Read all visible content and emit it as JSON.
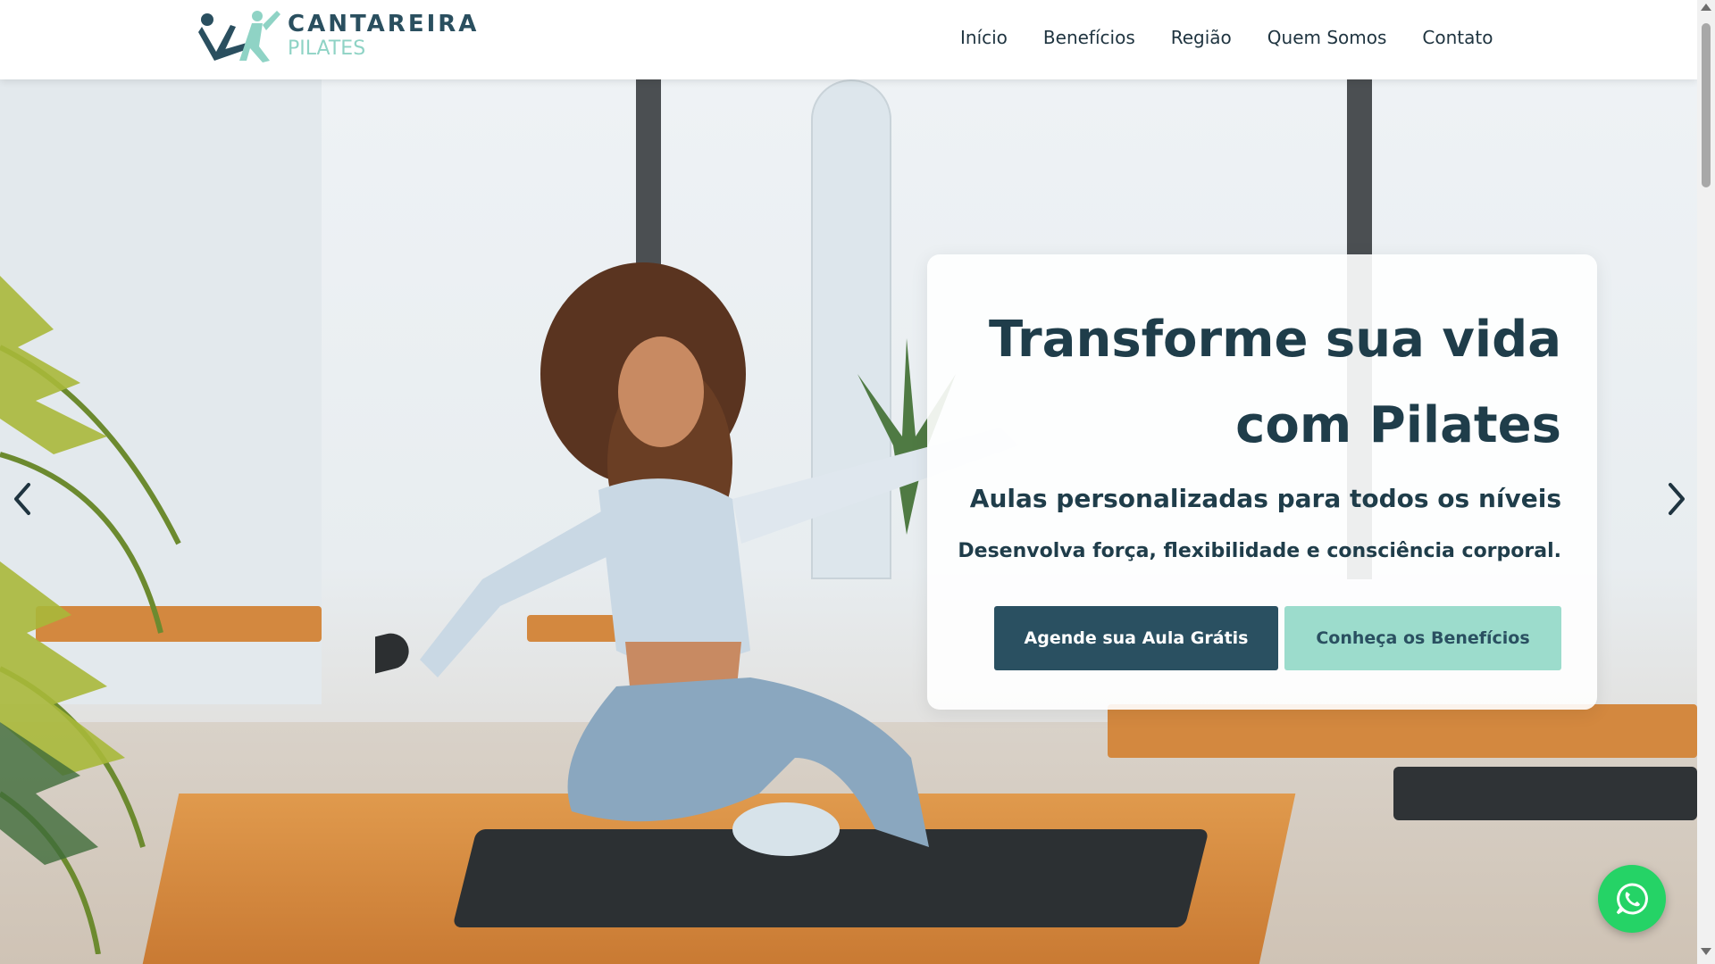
{
  "brand": {
    "line1": "CANTAREIRA",
    "line2": "PILATES",
    "primary_color": "#2a4f5f",
    "accent_color": "#8fd3c5"
  },
  "nav": {
    "items": [
      "Início",
      "Benefícios",
      "Região",
      "Quem Somos",
      "Contato"
    ]
  },
  "hero": {
    "title": "Transforme sua vida com Pilates",
    "subtitle": "Aulas personalizadas para todos os níveis",
    "description": "Desenvolva força, flexibilidade e consciência corporal.",
    "primary_button": "Agende sua Aula Grátis",
    "secondary_button": "Conheça os Benefícios",
    "prev_icon": "chevron-left-icon",
    "next_icon": "chevron-right-icon"
  },
  "floating": {
    "whatsapp_icon": "whatsapp-icon",
    "whatsapp_color": "#25d366"
  }
}
